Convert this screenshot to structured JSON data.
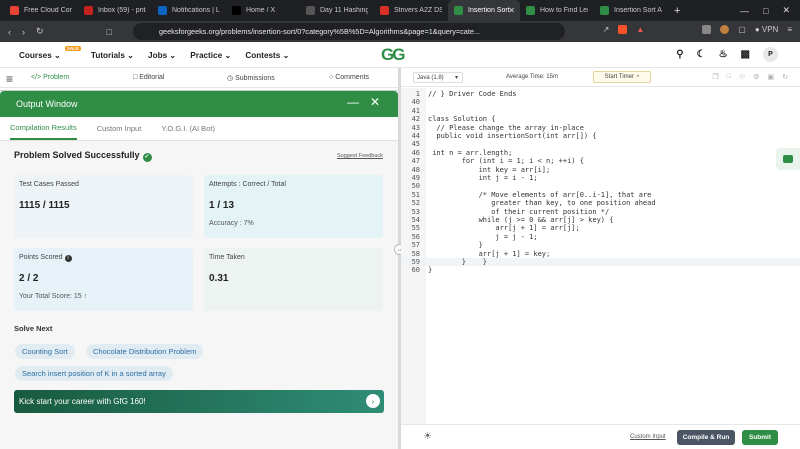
{
  "browser": {
    "tabs": [
      {
        "label": "Free Cloud Comp",
        "color": "#ea4335"
      },
      {
        "label": "Inbox (59) - pritar",
        "color": "#c5221f"
      },
      {
        "label": "Notifications | Lin",
        "color": "#0a66c2"
      },
      {
        "label": "Home / X",
        "color": "#000000"
      },
      {
        "label": "Day 11 Hashing |",
        "color": "#555555"
      },
      {
        "label": "Strivers A2Z DSA",
        "color": "#d93025"
      },
      {
        "label": "Insertion Sort",
        "color": "#2f8d46"
      },
      {
        "label": "How to Find Leng",
        "color": "#2f8d46"
      },
      {
        "label": "Insertion Sort Alg",
        "color": "#2f8d46"
      }
    ],
    "url": "geeksforgeeks.org/problems/insertion-sort/0?category%5B%5D=Algorithms&page=1&query=cate...",
    "vpn_label": "VPN"
  },
  "site": {
    "sale_badge": "SALE",
    "menu": [
      "Courses",
      "Tutorials",
      "Jobs",
      "Practice",
      "Contests"
    ],
    "logo": "GG",
    "avatar": "P"
  },
  "problem_tabs": [
    "Problem",
    "Editorial",
    "Submissions",
    "Comments"
  ],
  "output": {
    "title": "Output Window",
    "tabs": [
      "Compilation Results",
      "Custom Input",
      "Y.O.G.I. (AI Bot)"
    ],
    "status": "Problem Solved Successfully",
    "feedback": "Suggest Feedback",
    "cards": {
      "test_label": "Test Cases Passed",
      "test_value": "1115 / 1115",
      "attempts_label": "Attempts : Correct / Total",
      "attempts_value": "1 / 13",
      "accuracy": "Accuracy : 7%",
      "points_label": "Points Scored",
      "points_value": "2 / 2",
      "total_score": "Your Total Score: 15",
      "time_label": "Time Taken",
      "time_value": "0.31"
    },
    "solve_next": "Solve Next",
    "suggestions": [
      "Counting Sort",
      "Chocolate Distribution Problem",
      "Search insert position of K in a sorted array"
    ],
    "banner": "Kick start your career with GfG 160!"
  },
  "editor": {
    "language": "Java (1.8)",
    "avg_time": "Average Time: 15m",
    "timer": "Start Timer",
    "lines": [
      {
        "n": "1",
        "t": "// } Driver Code Ends",
        "c": "cm"
      },
      {
        "n": "40",
        "t": ""
      },
      {
        "n": "41",
        "t": ""
      },
      {
        "n": "42",
        "t": "class Solution {"
      },
      {
        "n": "43",
        "t": "  // Please change the array in-place",
        "c": "cm"
      },
      {
        "n": "44",
        "t": "  public void insertionSort(int arr[]) {"
      },
      {
        "n": "45",
        "t": ""
      },
      {
        "n": "46",
        "t": " int n = arr.length;"
      },
      {
        "n": "47",
        "t": "        for (int i = 1; i < n; ++i) {"
      },
      {
        "n": "48",
        "t": "            int key = arr[i];"
      },
      {
        "n": "49",
        "t": "            int j = i - 1;"
      },
      {
        "n": "50",
        "t": ""
      },
      {
        "n": "51",
        "t": "            /* Move elements of arr[0..i-1], that are",
        "c": "cm"
      },
      {
        "n": "52",
        "t": "               greater than key, to one position ahead",
        "c": "cm"
      },
      {
        "n": "53",
        "t": "               of their current position */",
        "c": "cm"
      },
      {
        "n": "54",
        "t": "            while (j >= 0 && arr[j] > key) {"
      },
      {
        "n": "55",
        "t": "                arr[j + 1] = arr[j];"
      },
      {
        "n": "56",
        "t": "                j = j - 1;"
      },
      {
        "n": "57",
        "t": "            }"
      },
      {
        "n": "58",
        "t": "            arr[j + 1] = key;"
      },
      {
        "n": "59",
        "t": "        }    }"
      },
      {
        "n": "60",
        "t": "}"
      }
    ],
    "custom_input": "Custom Input",
    "compile_run": "Compile & Run",
    "submit": "Submit"
  }
}
